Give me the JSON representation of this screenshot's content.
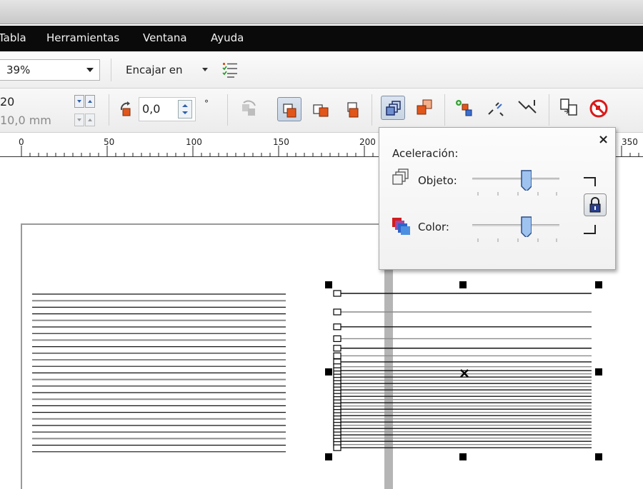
{
  "menu": {
    "items": [
      "Tabla",
      "Herramientas",
      "Ventana",
      "Ayuda"
    ]
  },
  "property_bar": {
    "zoom_value": "39%",
    "snap_label": "Encajar en"
  },
  "transform_bar": {
    "field_top": "20",
    "field_bottom": "10,0 mm",
    "angle_value": "0,0",
    "angle_unit": "°"
  },
  "ruler": {
    "labels": [
      "0",
      "50",
      "100",
      "150",
      "200",
      "350"
    ]
  },
  "acceleration_popup": {
    "title": "Aceleración:",
    "close": "×",
    "object_label": "Objeto:",
    "color_label": "Color:",
    "object_level": 0.62,
    "color_level": 0.62
  },
  "colors": {
    "menubar": "#0a0a0a",
    "accent_blue": "#3a6fd0",
    "accent_orange": "#e0561b",
    "guide": "#b5b5b5"
  }
}
